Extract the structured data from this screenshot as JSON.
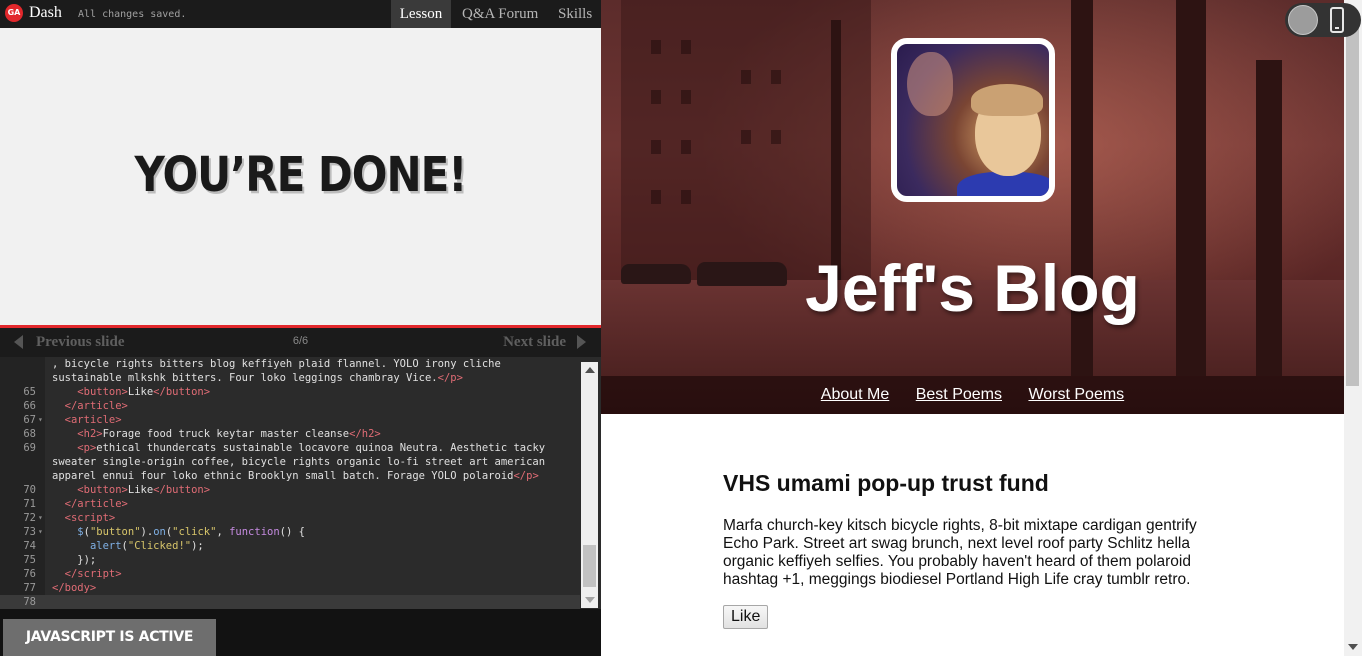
{
  "app": {
    "logo_text": "GA",
    "name": "Dash",
    "save_status": "All changes saved."
  },
  "topnav": {
    "tabs": [
      {
        "label": "Lesson",
        "active": true
      },
      {
        "label": "Q&A Forum",
        "active": false
      },
      {
        "label": "Skills",
        "active": false
      }
    ]
  },
  "slide": {
    "heading": "YOU’RE DONE!",
    "prev_label": "Previous slide",
    "next_label": "Next slide",
    "counter": "6/6"
  },
  "editor": {
    "lines": [
      {
        "num": "",
        "fold": false,
        "html": "<span>, bicycle rights bitters blog keffiyeh plaid flannel. YOLO irony cliche</span>"
      },
      {
        "num": "",
        "fold": false,
        "html": "<span>sustainable mlkshk bitters. Four loko leggings chambray Vice.</span><span class='t'>&lt;/p&gt;</span>"
      },
      {
        "num": "65",
        "fold": false,
        "html": "    <span class='t'>&lt;button&gt;</span>Like<span class='t'>&lt;/button&gt;</span>"
      },
      {
        "num": "66",
        "fold": false,
        "html": "  <span class='t'>&lt;/article&gt;</span>"
      },
      {
        "num": "67",
        "fold": true,
        "html": "  <span class='t'>&lt;article&gt;</span>"
      },
      {
        "num": "68",
        "fold": false,
        "html": "    <span class='t'>&lt;h2&gt;</span>Forage food truck keytar master cleanse<span class='t'>&lt;/h2&gt;</span>"
      },
      {
        "num": "69",
        "fold": false,
        "html": "    <span class='t'>&lt;p&gt;</span>ethical thundercats sustainable locavore quinoa Neutra. Aesthetic tacky"
      },
      {
        "num": "",
        "fold": false,
        "html": "sweater single-origin coffee, bicycle rights organic lo-fi street art american"
      },
      {
        "num": "",
        "fold": false,
        "html": "apparel ennui four loko ethnic Brooklyn small batch. Forage YOLO polaroid<span class='t'>&lt;/p&gt;</span>"
      },
      {
        "num": "70",
        "fold": false,
        "html": "    <span class='t'>&lt;button&gt;</span>Like<span class='t'>&lt;/button&gt;</span>"
      },
      {
        "num": "71",
        "fold": false,
        "html": "  <span class='t'>&lt;/article&gt;</span>"
      },
      {
        "num": "72",
        "fold": true,
        "html": "  <span class='t'>&lt;script&gt;</span>"
      },
      {
        "num": "73",
        "fold": true,
        "html": "    <span class='fn'>$</span>(<span class='s'>\"button\"</span>).<span class='fn'>on</span>(<span class='s'>\"click\"</span>, <span class='k'>function</span>() {"
      },
      {
        "num": "74",
        "fold": false,
        "html": "      <span class='fn'>alert</span>(<span class='s'>\"Clicked!\"</span>);"
      },
      {
        "num": "75",
        "fold": false,
        "html": "    });"
      },
      {
        "num": "76",
        "fold": false,
        "html": "  <span class='t'>&lt;/script&gt;</span>"
      },
      {
        "num": "77",
        "fold": false,
        "html": "<span class='t'>&lt;/body&gt;</span>"
      },
      {
        "num": "78",
        "fold": false,
        "html": "",
        "active": true
      }
    ]
  },
  "console": {
    "status": "JAVASCRIPT IS ACTIVE"
  },
  "preview": {
    "blog_title": "Jeff's Blog",
    "nav": [
      "About Me",
      "Best Poems",
      "Worst Poems"
    ],
    "post": {
      "title": "VHS umami pop-up trust fund",
      "body": "Marfa church-key kitsch bicycle rights, 8-bit mixtape cardigan gentrify Echo Park. Street art swag brunch, next level roof party Schlitz hella organic keffiyeh selfies. You probably haven't heard of them polaroid hashtag +1, meggings biodiesel Portland High Life cray tumblr retro.",
      "like_label": "Like"
    }
  },
  "colors": {
    "accent": "#e2282c",
    "editor_bg": "#2b2b2b",
    "tag": "#e06c75",
    "string": "#d7c56a"
  },
  "icons": [
    "ga-logo-icon",
    "prev-arrow-icon",
    "next-arrow-icon",
    "scroll-up-icon",
    "scroll-down-icon",
    "mobile-device-icon",
    "toggle-circle-icon"
  ]
}
